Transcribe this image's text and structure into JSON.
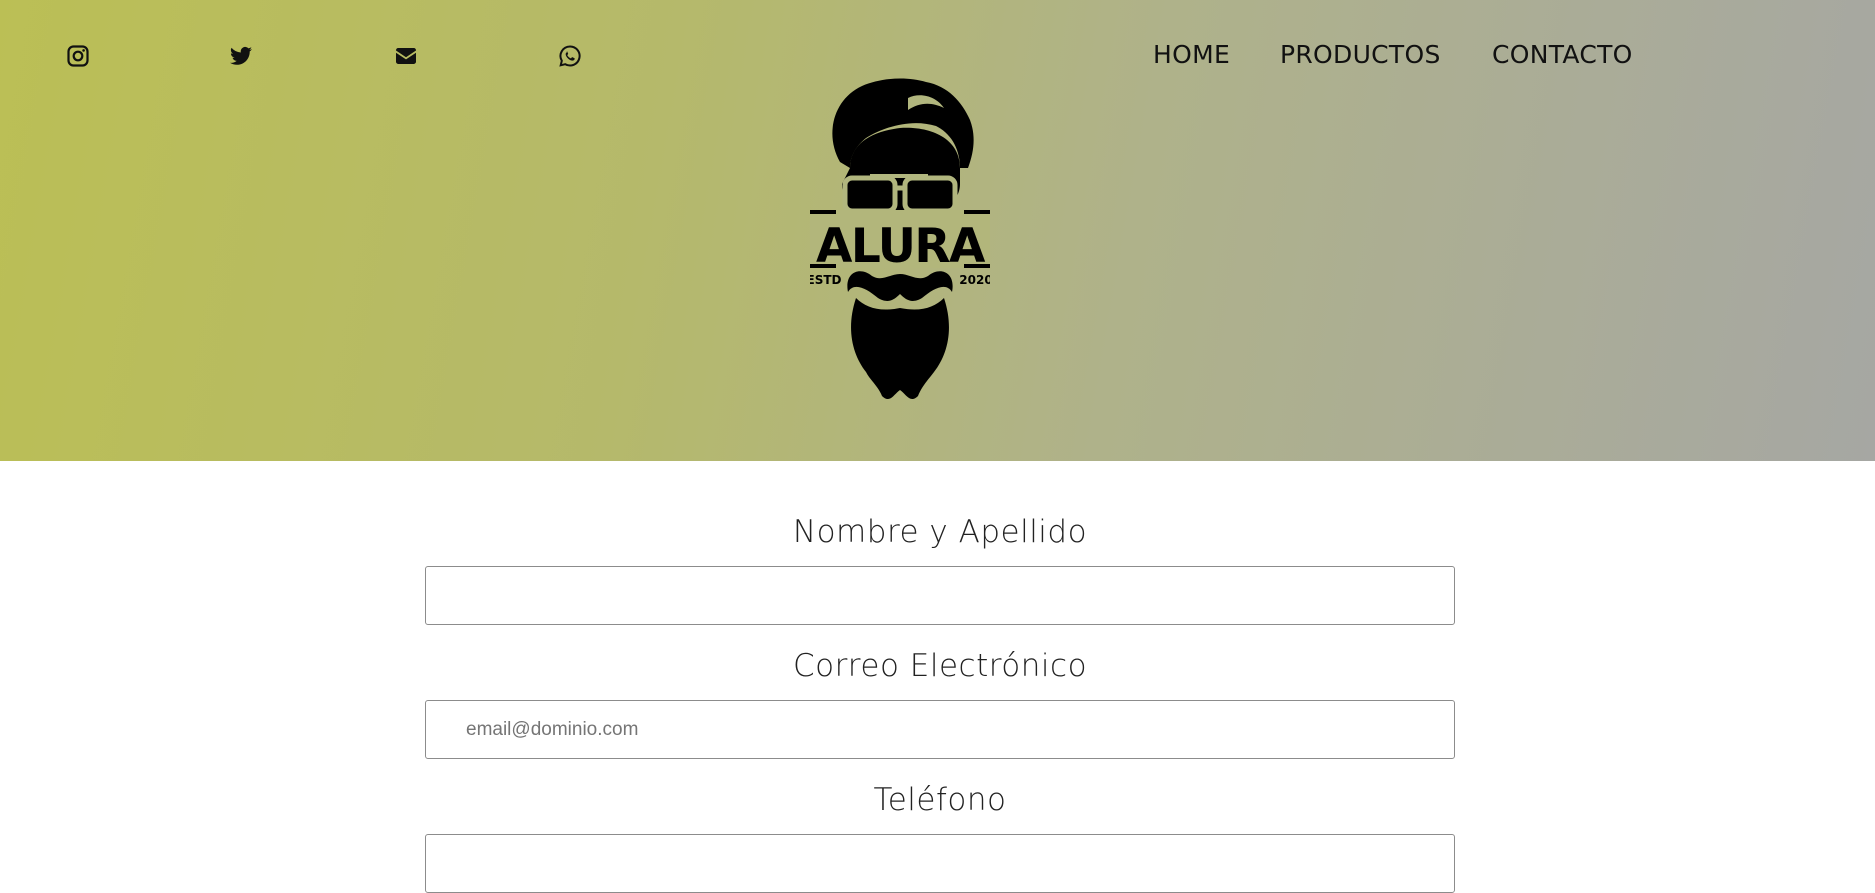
{
  "header": {
    "social_icons": [
      {
        "name": "instagram-icon"
      },
      {
        "name": "twitter-icon"
      },
      {
        "name": "envelope-icon"
      },
      {
        "name": "whatsapp-icon"
      }
    ],
    "nav": {
      "home": "HOME",
      "productos": "PRODUCTOS",
      "contacto": "CONTACTO"
    },
    "logo": {
      "brand": "ALURA",
      "left_text": "ESTD",
      "right_text": "2020"
    },
    "gradient_colors": [
      "#bbbf55",
      "#a6a7a3"
    ]
  },
  "form": {
    "name_label": "Nombre y Apellido",
    "name_value": "",
    "email_label": "Correo Electrónico",
    "email_placeholder": "email@dominio.com",
    "phone_label": "Teléfono",
    "phone_value": ""
  }
}
